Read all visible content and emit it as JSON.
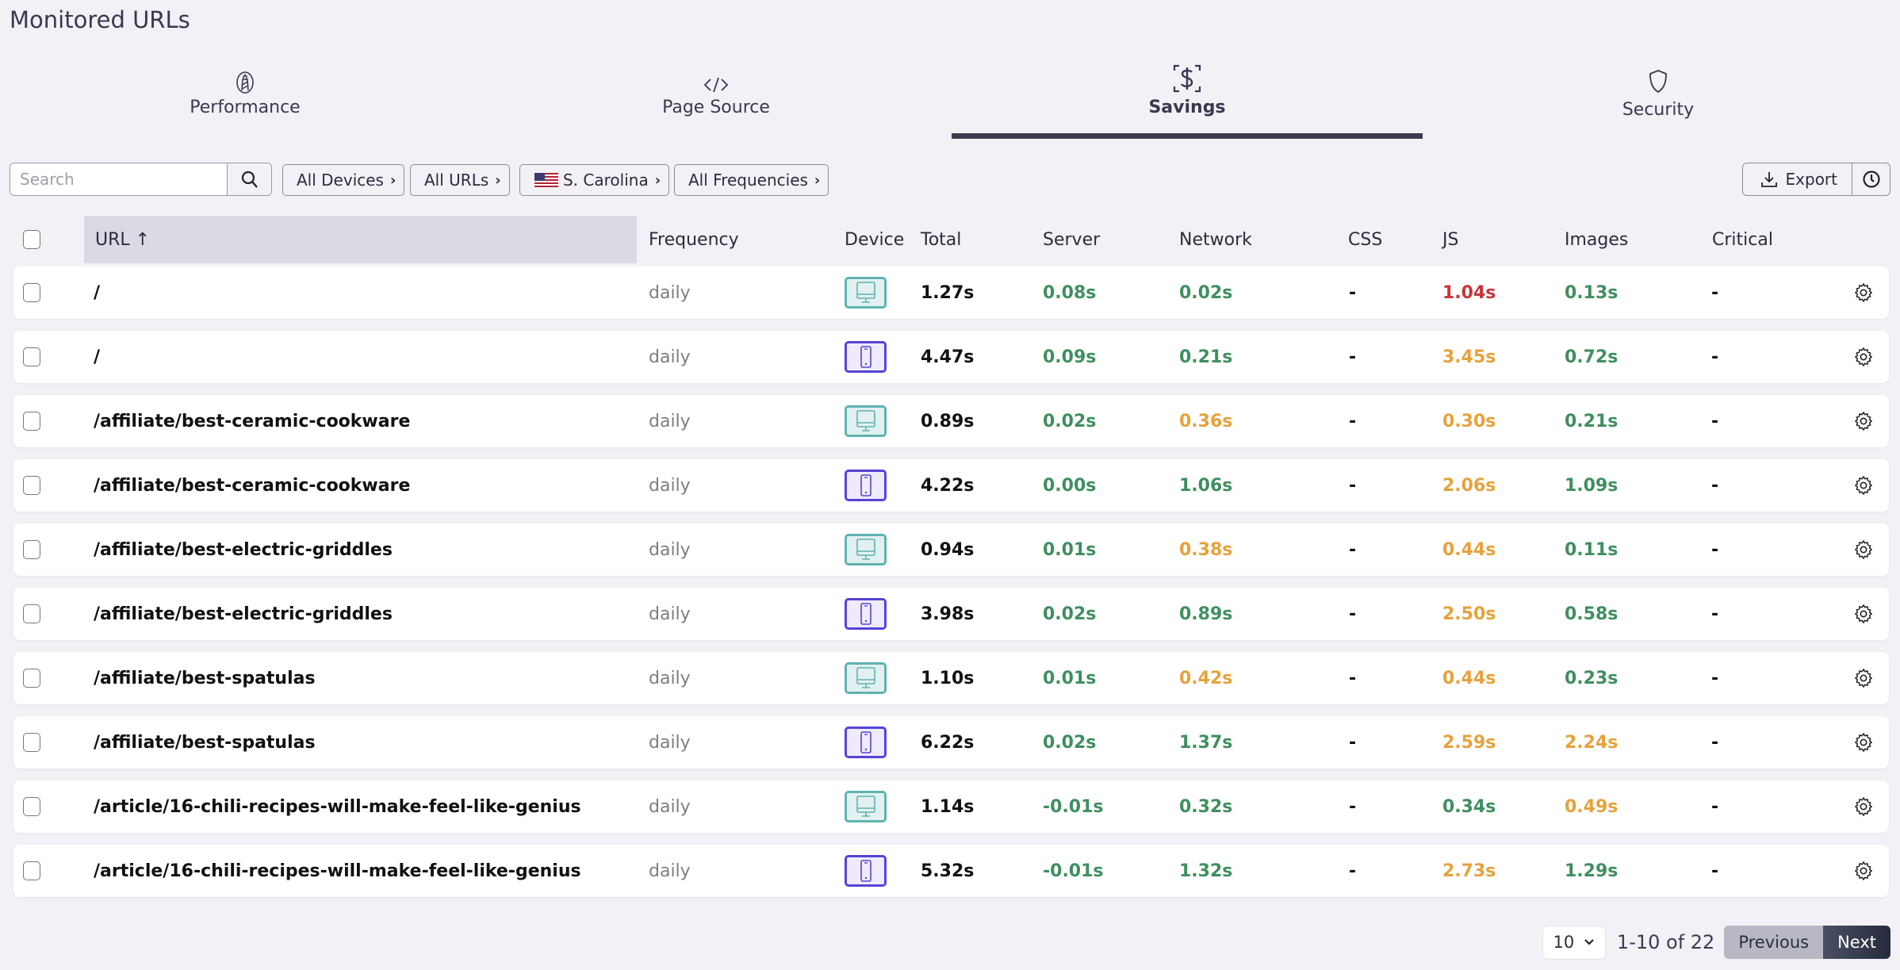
{
  "page": {
    "title": "Monitored URLs"
  },
  "tabs": [
    {
      "label": "Performance",
      "icon": "lighthouse-icon",
      "active": false
    },
    {
      "label": "Page Source",
      "icon": "code-icon",
      "active": false
    },
    {
      "label": "Savings",
      "icon": "dollar-scan-icon",
      "active": true
    },
    {
      "label": "Security",
      "icon": "shield-icon",
      "active": false
    }
  ],
  "toolbar": {
    "search_placeholder": "Search",
    "search_value": "",
    "filters": [
      {
        "label": "All Devices"
      },
      {
        "label": "All URLs"
      },
      {
        "label": "S. Carolina",
        "flag": "us-flag"
      },
      {
        "label": "All Frequencies"
      }
    ],
    "export_label": "Export"
  },
  "table": {
    "columns": [
      "URL ↑",
      "Frequency",
      "Device",
      "Total",
      "Server",
      "Network",
      "CSS",
      "JS",
      "Images",
      "Critical"
    ],
    "colors": {
      "good": "#3f8f5f",
      "warn": "#e6a23c",
      "bad": "#c8353a"
    },
    "rows": [
      {
        "url": "/",
        "frequency": "daily",
        "device": "desktop",
        "total": "1.27s",
        "server": [
          "0.08s",
          "good"
        ],
        "network": [
          "0.02s",
          "good"
        ],
        "css": "-",
        "js": [
          "1.04s",
          "bad"
        ],
        "images": [
          "0.13s",
          "good"
        ],
        "critical": "-"
      },
      {
        "url": "/",
        "frequency": "daily",
        "device": "mobile",
        "total": "4.47s",
        "server": [
          "0.09s",
          "good"
        ],
        "network": [
          "0.21s",
          "good"
        ],
        "css": "-",
        "js": [
          "3.45s",
          "warn"
        ],
        "images": [
          "0.72s",
          "good"
        ],
        "critical": "-"
      },
      {
        "url": "/affiliate/best-ceramic-cookware",
        "frequency": "daily",
        "device": "desktop",
        "total": "0.89s",
        "server": [
          "0.02s",
          "good"
        ],
        "network": [
          "0.36s",
          "warn"
        ],
        "css": "-",
        "js": [
          "0.30s",
          "warn"
        ],
        "images": [
          "0.21s",
          "good"
        ],
        "critical": "-"
      },
      {
        "url": "/affiliate/best-ceramic-cookware",
        "frequency": "daily",
        "device": "mobile",
        "total": "4.22s",
        "server": [
          "0.00s",
          "good"
        ],
        "network": [
          "1.06s",
          "good"
        ],
        "css": "-",
        "js": [
          "2.06s",
          "warn"
        ],
        "images": [
          "1.09s",
          "good"
        ],
        "critical": "-"
      },
      {
        "url": "/affiliate/best-electric-griddles",
        "frequency": "daily",
        "device": "desktop",
        "total": "0.94s",
        "server": [
          "0.01s",
          "good"
        ],
        "network": [
          "0.38s",
          "warn"
        ],
        "css": "-",
        "js": [
          "0.44s",
          "warn"
        ],
        "images": [
          "0.11s",
          "good"
        ],
        "critical": "-"
      },
      {
        "url": "/affiliate/best-electric-griddles",
        "frequency": "daily",
        "device": "mobile",
        "total": "3.98s",
        "server": [
          "0.02s",
          "good"
        ],
        "network": [
          "0.89s",
          "good"
        ],
        "css": "-",
        "js": [
          "2.50s",
          "warn"
        ],
        "images": [
          "0.58s",
          "good"
        ],
        "critical": "-"
      },
      {
        "url": "/affiliate/best-spatulas",
        "frequency": "daily",
        "device": "desktop",
        "total": "1.10s",
        "server": [
          "0.01s",
          "good"
        ],
        "network": [
          "0.42s",
          "warn"
        ],
        "css": "-",
        "js": [
          "0.44s",
          "warn"
        ],
        "images": [
          "0.23s",
          "good"
        ],
        "critical": "-"
      },
      {
        "url": "/affiliate/best-spatulas",
        "frequency": "daily",
        "device": "mobile",
        "total": "6.22s",
        "server": [
          "0.02s",
          "good"
        ],
        "network": [
          "1.37s",
          "good"
        ],
        "css": "-",
        "js": [
          "2.59s",
          "warn"
        ],
        "images": [
          "2.24s",
          "warn"
        ],
        "critical": "-"
      },
      {
        "url": "/article/16-chili-recipes-will-make-feel-like-genius",
        "frequency": "daily",
        "device": "desktop",
        "total": "1.14s",
        "server": [
          "-0.01s",
          "good"
        ],
        "network": [
          "0.32s",
          "good"
        ],
        "css": "-",
        "js": [
          "0.34s",
          "good"
        ],
        "images": [
          "0.49s",
          "warn"
        ],
        "critical": "-"
      },
      {
        "url": "/article/16-chili-recipes-will-make-feel-like-genius",
        "frequency": "daily",
        "device": "mobile",
        "total": "5.32s",
        "server": [
          "-0.01s",
          "good"
        ],
        "network": [
          "1.32s",
          "good"
        ],
        "css": "-",
        "js": [
          "2.73s",
          "warn"
        ],
        "images": [
          "1.29s",
          "good"
        ],
        "critical": "-"
      }
    ]
  },
  "pagination": {
    "per_page": "10",
    "range": "1-10 of 22",
    "previous_label": "Previous",
    "next_label": "Next"
  }
}
